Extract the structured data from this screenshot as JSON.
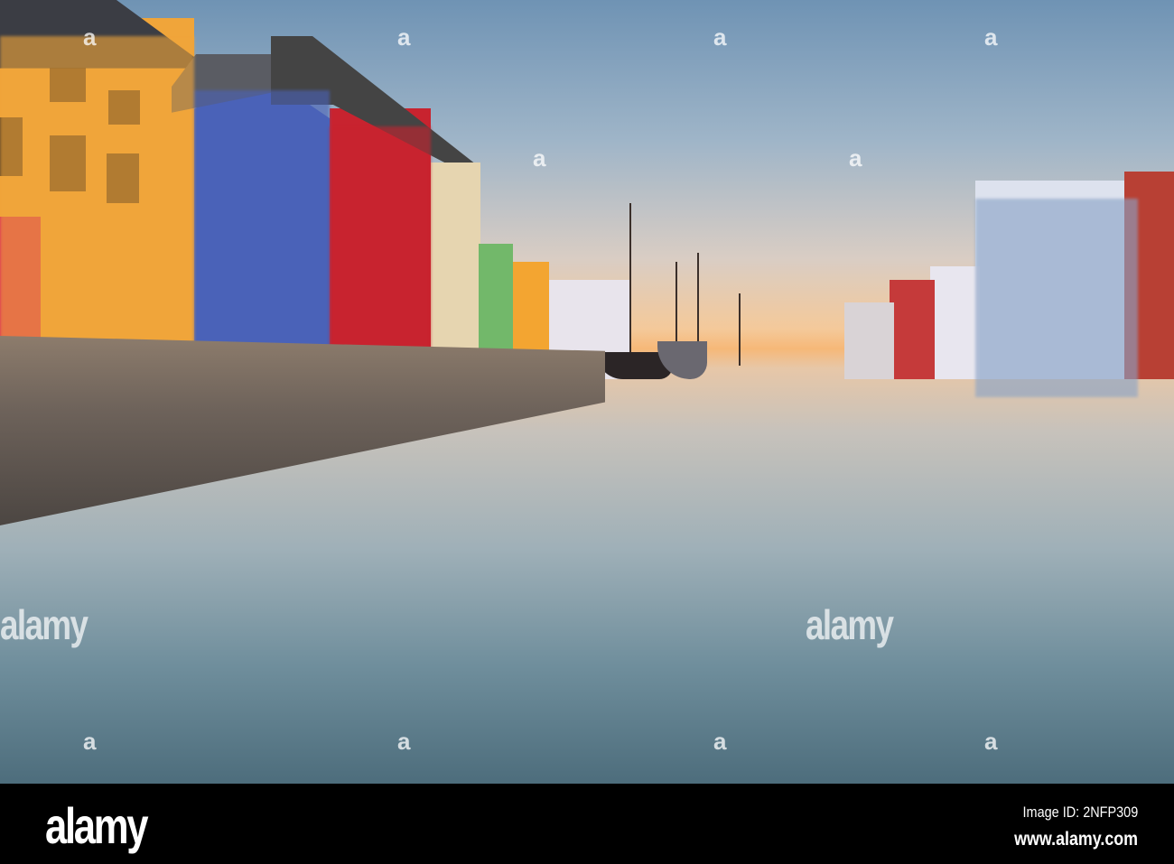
{
  "watermark": {
    "text": "alamy",
    "mark": "a"
  },
  "footer": {
    "logo": "alamy",
    "image_id": "Image ID: 2NFP309",
    "url": "www.alamy.com"
  },
  "colors": {
    "sky_top": "#6f93b4",
    "sunrise": "#f6b878",
    "yellow_house": "#f0a53a",
    "blue_house": "#4a62b8",
    "red_house": "#c8232f"
  }
}
